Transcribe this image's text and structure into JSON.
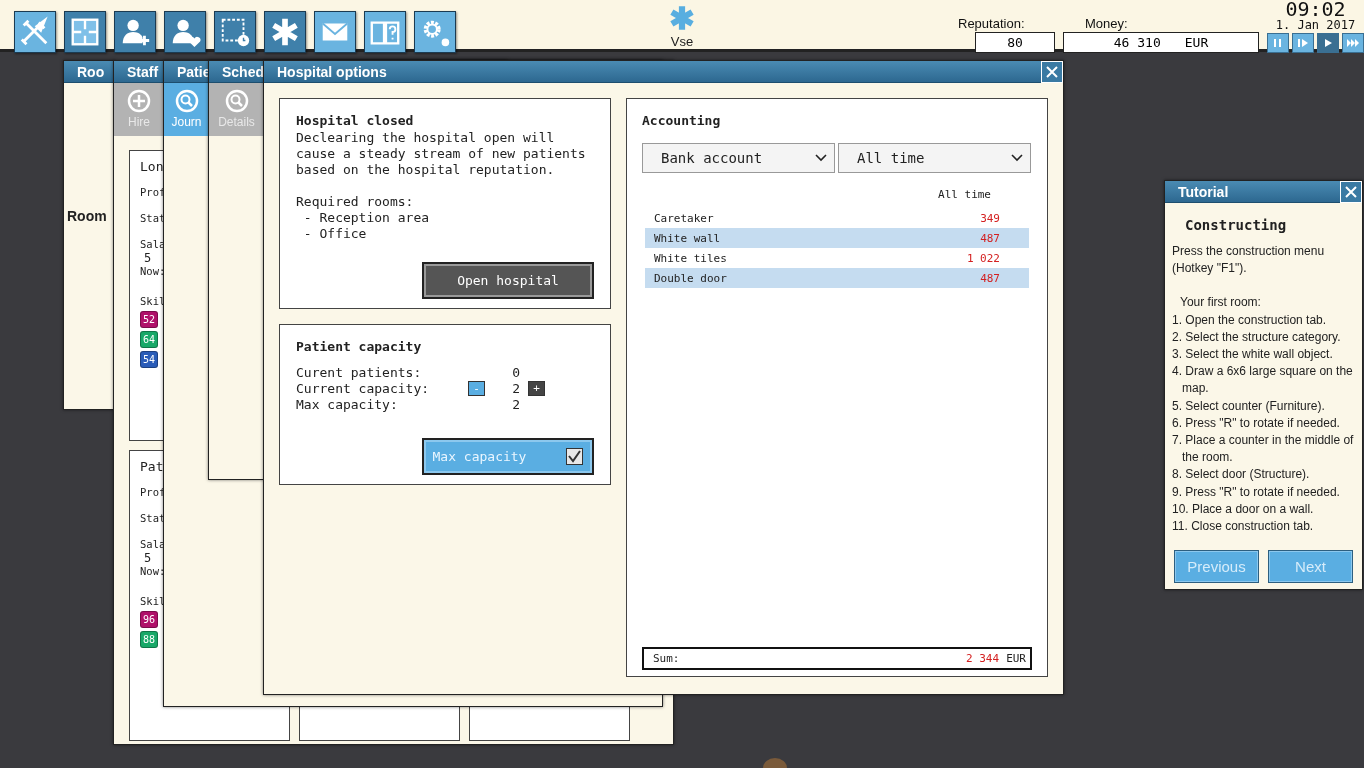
{
  "top_bar": {
    "tool_buttons": [
      {
        "active": false
      },
      {
        "active": true
      },
      {
        "active": true
      },
      {
        "active": true
      },
      {
        "active": true
      },
      {
        "active": true
      },
      {
        "active": false
      },
      {
        "active": false
      },
      {
        "active": false
      }
    ],
    "category": {
      "label": "Vse"
    },
    "reputation": {
      "label": "Reputation:",
      "value": "80"
    },
    "money": {
      "label": "Money:",
      "value": "46 310",
      "currency": "EUR"
    },
    "clock": {
      "time": "09:02",
      "date": "1. Jan 2017"
    },
    "speed_buttons": [
      {
        "selected": false
      },
      {
        "selected": false
      },
      {
        "selected": true
      },
      {
        "selected": false
      }
    ]
  },
  "room_window": {
    "title": "Roo",
    "body_text": "Room"
  },
  "staff_window": {
    "title": "Staff",
    "tabs": [
      {
        "label": "Hire",
        "selected": false
      }
    ],
    "cards": [
      {
        "name": "Lon",
        "profession_label": "Prof",
        "status_label": "Stat",
        "salary_label": "Sala",
        "salary_value": "5",
        "now_label": "Now:",
        "skills_label": "Skil",
        "skills": [
          {
            "value": "52",
            "color": "#b0106a"
          },
          {
            "value": "64",
            "color": "#18a868"
          },
          {
            "value": "54",
            "color": "#2a5cb8"
          }
        ]
      },
      {
        "name": "Pat",
        "profession_label": "Prof",
        "status_label": "Stat",
        "salary_label": "Sala",
        "salary_value": "5",
        "now_label": "Now:",
        "skills_label": "Skil",
        "skills": [
          {
            "value": "96",
            "color": "#b0106a"
          },
          {
            "value": "88",
            "color": "#18a868"
          }
        ]
      }
    ]
  },
  "patients_window": {
    "title": "Patie",
    "tabs": [
      {
        "label": "Journ",
        "selected": true
      }
    ]
  },
  "schedule_window": {
    "title": "Sched",
    "tabs": [
      {
        "label": "Details",
        "selected": false
      }
    ]
  },
  "hospital_options": {
    "title": "Hospital options",
    "status_panel": {
      "heading": "Hospital closed",
      "description": "Declearing the hospital open will cause a steady stream of new patients based on the hospital reputation.",
      "rooms_label": "Required rooms:",
      "rooms": [
        "- Reception area",
        "- Office"
      ],
      "button": "Open hospital"
    },
    "capacity_panel": {
      "heading": "Patient capacity",
      "rows": [
        {
          "kind": "plain",
          "label": "Curent patients:",
          "value": "0"
        },
        {
          "kind": "stepper",
          "label": "Current capacity:",
          "value": "2",
          "decrement": "-",
          "increment": "+"
        },
        {
          "kind": "plain",
          "label": "Max capacity:",
          "value": "2"
        }
      ],
      "max_toggle": {
        "label": "Max capacity",
        "checked": true
      }
    },
    "accounting": {
      "heading": "Accounting",
      "account_select": "Bank account",
      "period_select": "All time",
      "column_header": "All time",
      "rows": [
        {
          "item": "Caretaker",
          "amount": "349"
        },
        {
          "item": "White wall",
          "amount": "487"
        },
        {
          "item": "White tiles",
          "amount": "1 022"
        },
        {
          "item": "Double door",
          "amount": "487"
        }
      ],
      "sum_label": "Sum:",
      "sum_value": "2 344",
      "currency": "EUR"
    }
  },
  "tutorial": {
    "title": "Tutorial",
    "heading": "Constructing",
    "intro": "Press the construction menu (Hotkey \"F1\").",
    "subheading": "Your first room:",
    "steps": [
      "1. Open the construction tab.",
      "2. Select the structure category.",
      "3. Select the white wall object.",
      "4. Draw a 6x6 large square on the map.",
      "5. Select counter (Furniture).",
      "6. Press \"R\" to rotate if needed.",
      "7. Place a counter in the middle of the room.",
      "8. Select door (Structure).",
      "9. Press \"R\" to rotate if needed.",
      "10. Place a door on a wall.",
      "11. Close construction tab."
    ],
    "buttons": [
      "Previous",
      "Next"
    ]
  }
}
